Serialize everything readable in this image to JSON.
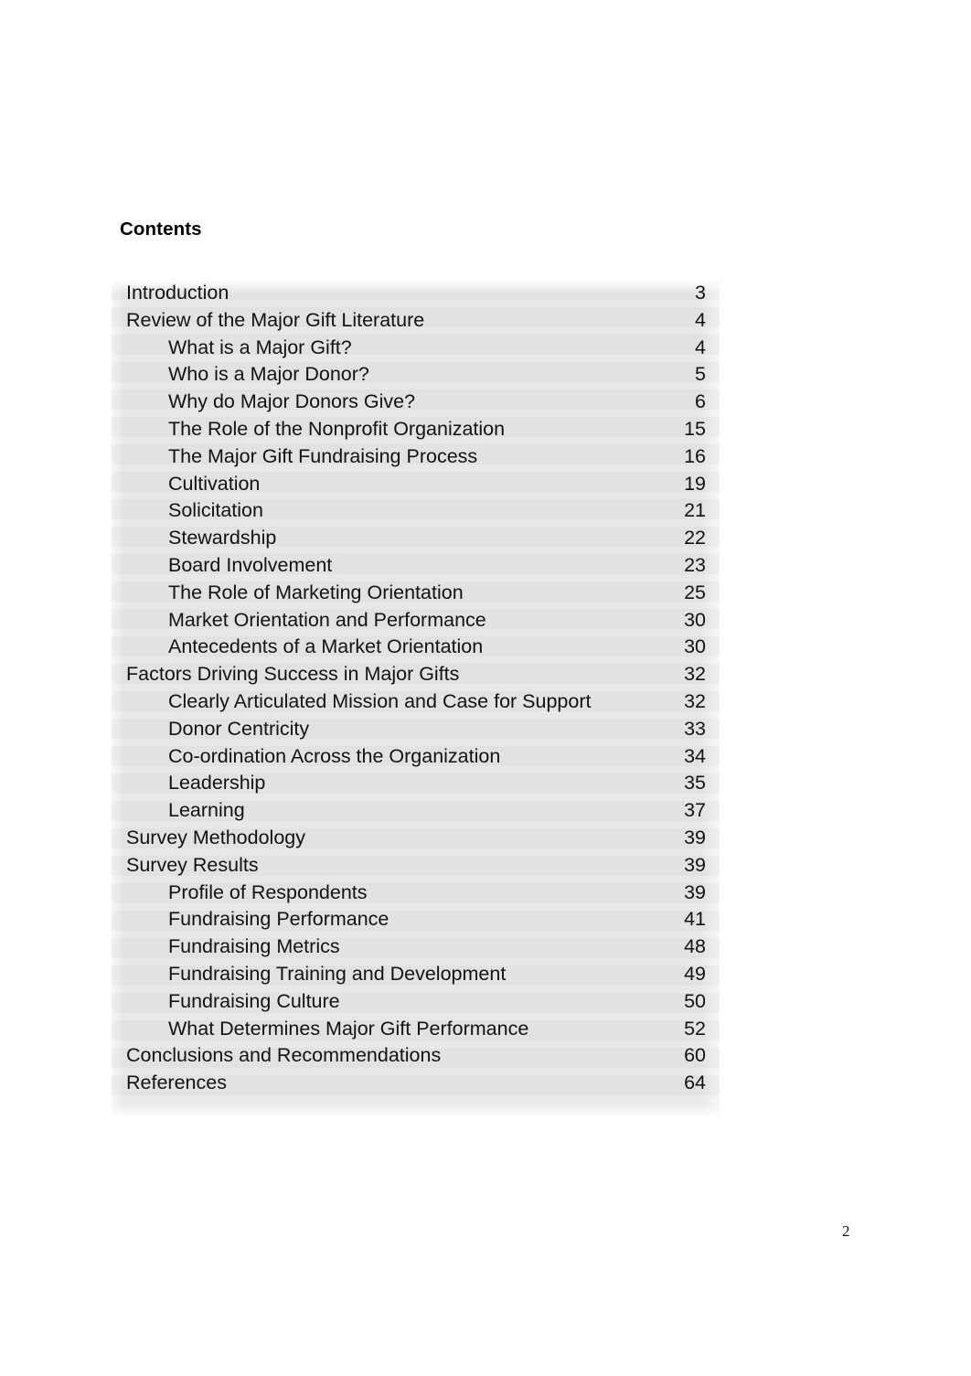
{
  "document": {
    "heading": "Contents",
    "footer_page_number": "2",
    "shading_color": "#f0f0f1",
    "text_color": "#121212"
  },
  "toc": {
    "entries": [
      {
        "title": "Introduction",
        "page": "3",
        "level": 1
      },
      {
        "title": "Review of the Major Gift Literature",
        "page": "4",
        "level": 1
      },
      {
        "title": "What is a Major Gift?",
        "page": "4",
        "level": 2
      },
      {
        "title": "Who is a Major Donor?",
        "page": "5",
        "level": 2
      },
      {
        "title": "Why do Major Donors Give?",
        "page": "6",
        "level": 2
      },
      {
        "title": "The Role of the Nonprofit Organization",
        "page": "15",
        "level": 2
      },
      {
        "title": "The Major Gift Fundraising Process",
        "page": "16",
        "level": 2
      },
      {
        "title": "Cultivation",
        "page": "19",
        "level": 2
      },
      {
        "title": "Solicitation",
        "page": "21",
        "level": 2
      },
      {
        "title": "Stewardship",
        "page": "22",
        "level": 2
      },
      {
        "title": "Board Involvement",
        "page": "23",
        "level": 2
      },
      {
        "title": "The Role of Marketing Orientation",
        "page": "25",
        "level": 2
      },
      {
        "title": "Market Orientation and Performance",
        "page": "30",
        "level": 2
      },
      {
        "title": "Antecedents of a Market Orientation",
        "page": "30",
        "level": 2
      },
      {
        "title": "Factors Driving Success in Major Gifts",
        "page": "32",
        "level": 1
      },
      {
        "title": "Clearly Articulated Mission and Case for Support",
        "page": "32",
        "level": 2
      },
      {
        "title": "Donor Centricity",
        "page": "33",
        "level": 2
      },
      {
        "title": "Co-ordination Across the Organization",
        "page": "34",
        "level": 2
      },
      {
        "title": "Leadership",
        "page": "35",
        "level": 2
      },
      {
        "title": "Learning",
        "page": "37",
        "level": 2
      },
      {
        "title": "Survey Methodology",
        "page": "39",
        "level": 1
      },
      {
        "title": "Survey Results",
        "page": "39",
        "level": 1
      },
      {
        "title": "Profile of Respondents",
        "page": "39",
        "level": 2
      },
      {
        "title": "Fundraising Performance",
        "page": "41",
        "level": 2
      },
      {
        "title": "Fundraising Metrics",
        "page": "48",
        "level": 2
      },
      {
        "title": "Fundraising Training and Development",
        "page": "49",
        "level": 2
      },
      {
        "title": "Fundraising Culture",
        "page": "50",
        "level": 2
      },
      {
        "title": "What Determines Major Gift Performance",
        "page": "52",
        "level": 2
      },
      {
        "title": "Conclusions and Recommendations",
        "page": "60",
        "level": 1
      },
      {
        "title": "References",
        "page": "64",
        "level": 1
      }
    ]
  }
}
